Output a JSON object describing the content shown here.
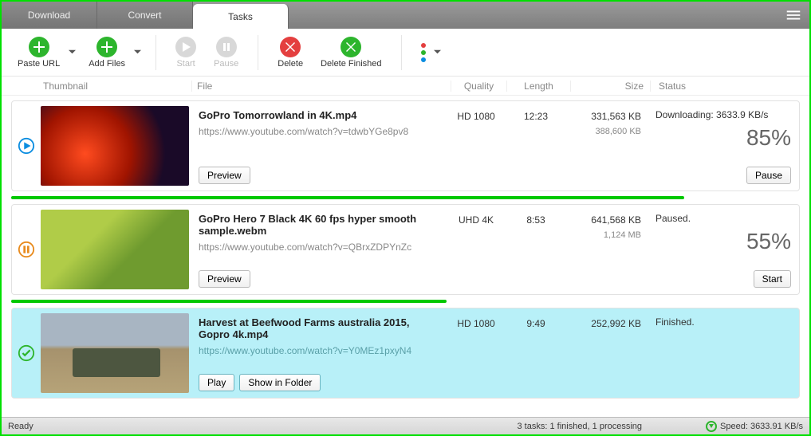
{
  "tabs": {
    "download": "Download",
    "convert": "Convert",
    "tasks": "Tasks"
  },
  "toolbar": {
    "paste_url": "Paste URL",
    "add_files": "Add Files",
    "start": "Start",
    "pause": "Pause",
    "delete": "Delete",
    "delete_finished": "Delete Finished"
  },
  "headers": {
    "thumbnail": "Thumbnail",
    "file": "File",
    "quality": "Quality",
    "length": "Length",
    "size": "Size",
    "status": "Status"
  },
  "tasks": [
    {
      "title": "GoPro  Tomorrowland in 4K.mp4",
      "url": "https://www.youtube.com/watch?v=tdwbYGe8pv8",
      "quality": "HD 1080",
      "length": "12:23",
      "size": "331,563 KB",
      "size_sub": "388,600 KB",
      "status": "Downloading: 3633.9 KB/s",
      "percent": "85%",
      "preview_btn": "Preview",
      "action_btn": "Pause",
      "progress": 85
    },
    {
      "title": "GoPro Hero 7 Black 4K 60 fps hyper smooth sample.webm",
      "url": "https://www.youtube.com/watch?v=QBrxZDPYnZc",
      "quality": "UHD 4K",
      "length": "8:53",
      "size": "641,568 KB",
      "size_sub": "1,124 MB",
      "status": "Paused.",
      "percent": "55%",
      "preview_btn": "Preview",
      "action_btn": "Start",
      "progress": 55
    },
    {
      "title": "Harvest at Beefwood Farms australia 2015, Gopro 4k.mp4",
      "url": "https://www.youtube.com/watch?v=Y0MEz1pxyN4",
      "quality": "HD 1080",
      "length": "9:49",
      "size": "252,992 KB",
      "size_sub": "",
      "status": "Finished.",
      "percent": "",
      "play_btn": "Play",
      "folder_btn": "Show in Folder",
      "progress": 100
    }
  ],
  "statusbar": {
    "ready": "Ready",
    "tasks": "3 tasks: 1 finished, 1 processing",
    "speed": "Speed: 3633.91 KB/s"
  }
}
